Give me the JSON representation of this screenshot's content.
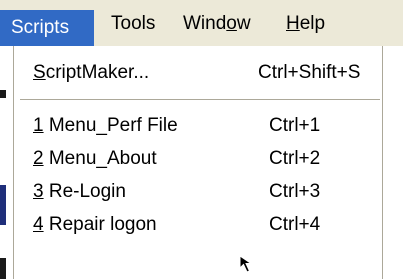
{
  "menubar": {
    "items": [
      {
        "label": "Scripts",
        "active": true
      },
      {
        "label_pre": "Tools",
        "label_mn": "",
        "label_post": "",
        "active": false
      },
      {
        "label_pre": "Wind",
        "label_mn": "o",
        "label_post": "w",
        "active": false
      },
      {
        "label_pre": "",
        "label_mn": "H",
        "label_post": "elp",
        "active": false
      }
    ]
  },
  "scripts_menu": {
    "items": [
      {
        "mn": "S",
        "rest": "criptMaker...",
        "shortcut": "Ctrl+Shift+S"
      },
      {
        "mn": "1",
        "rest": " Menu_Perf File",
        "shortcut": "Ctrl+1"
      },
      {
        "mn": "2",
        "rest": " Menu_About",
        "shortcut": "Ctrl+2"
      },
      {
        "mn": "3",
        "rest": " Re-Login",
        "shortcut": "Ctrl+3"
      },
      {
        "mn": "4",
        "rest": " Repair logon",
        "shortcut": "Ctrl+4"
      }
    ]
  },
  "colors": {
    "menubar_bg": "#ece9d8",
    "highlight": "#316ac5",
    "menu_bg": "#ffffff",
    "separator": "#aca899"
  },
  "cursor": "arrow-pointer-icon"
}
